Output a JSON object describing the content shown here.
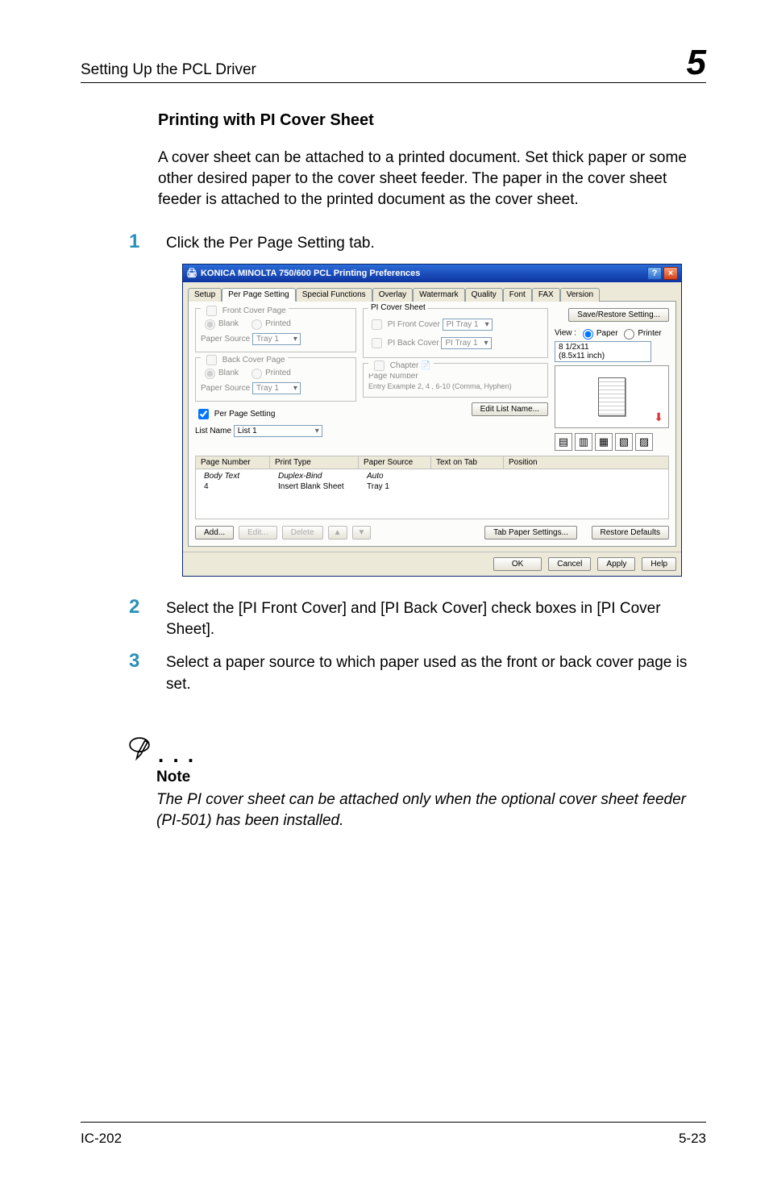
{
  "header": {
    "title": "Setting Up the PCL Driver",
    "chapter": "5"
  },
  "section": {
    "title": "Printing with PI Cover Sheet"
  },
  "intro": "A cover sheet can be attached to a printed document. Set thick paper or some other desired paper to the cover sheet feeder. The paper in the cover sheet feeder is attached to the printed document as the cover sheet.",
  "steps": [
    {
      "num": "1",
      "text": "Click the Per Page Setting tab."
    },
    {
      "num": "2",
      "text": "Select the [PI Front Cover] and [PI Back Cover] check boxes in [PI Cover Sheet]."
    },
    {
      "num": "3",
      "text": "Select a paper source to which paper used as the front or back cover page is set."
    }
  ],
  "note": {
    "dots": ". . .",
    "label": "Note",
    "text": "The PI cover sheet can be attached only when the optional cover sheet feeder (PI-501) has been installed."
  },
  "footer": {
    "left": "IC-202",
    "right": "5-23"
  },
  "dlg": {
    "title": "KONICA MINOLTA 750/600 PCL Printing Preferences",
    "help": "?",
    "close": "×",
    "tabs": [
      "Setup",
      "Per Page Setting",
      "Special Functions",
      "Overlay",
      "Watermark",
      "Quality",
      "Font",
      "FAX",
      "Version"
    ],
    "activeTab": 1,
    "left": {
      "front": {
        "title": "Front Cover Page",
        "blank": "Blank",
        "printed": "Printed",
        "psLabel": "Paper Source",
        "psValue": "Tray 1"
      },
      "back": {
        "title": "Back Cover Page",
        "blank": "Blank",
        "printed": "Printed",
        "psLabel": "Paper Source",
        "psValue": "Tray 1"
      },
      "pps": {
        "chk": "Per Page Setting",
        "lnLabel": "List Name",
        "lnValue": "List 1",
        "editBtn": "Edit List Name..."
      }
    },
    "mid": {
      "pi": {
        "title": "PI Cover Sheet",
        "front": "PI Front Cover",
        "frontTray": "PI Tray 1",
        "back": "PI Back Cover",
        "backTray": "PI Tray 1"
      },
      "ch": {
        "title": "Chapter",
        "pnLabel": "Page Number",
        "hint": "Entry Example 2, 4 , 6-10 (Comma, Hyphen)"
      }
    },
    "right": {
      "save": "Save/Restore Setting...",
      "viewLabel": "View :",
      "paper": "Paper",
      "printer": "Printer",
      "size": "8 1/2x11",
      "sizeIn": "(8.5x11 inch)",
      "restore": "Restore Defaults"
    },
    "list": {
      "cols": [
        "Page Number",
        "Print Type",
        "Paper Source",
        "Text on Tab",
        "Position"
      ],
      "rows": [
        [
          "Body Text",
          "Duplex-Bind",
          "Auto",
          "",
          ""
        ],
        [
          "4",
          "Insert Blank Sheet",
          "Tray 1",
          "",
          ""
        ]
      ]
    },
    "rowbtns": {
      "add": "Add...",
      "edit": "Edit...",
      "delete": "Delete",
      "up": "▲",
      "down": "▼",
      "tab": "Tab Paper Settings..."
    },
    "bottom": {
      "ok": "OK",
      "cancel": "Cancel",
      "apply": "Apply",
      "help": "Help"
    }
  }
}
